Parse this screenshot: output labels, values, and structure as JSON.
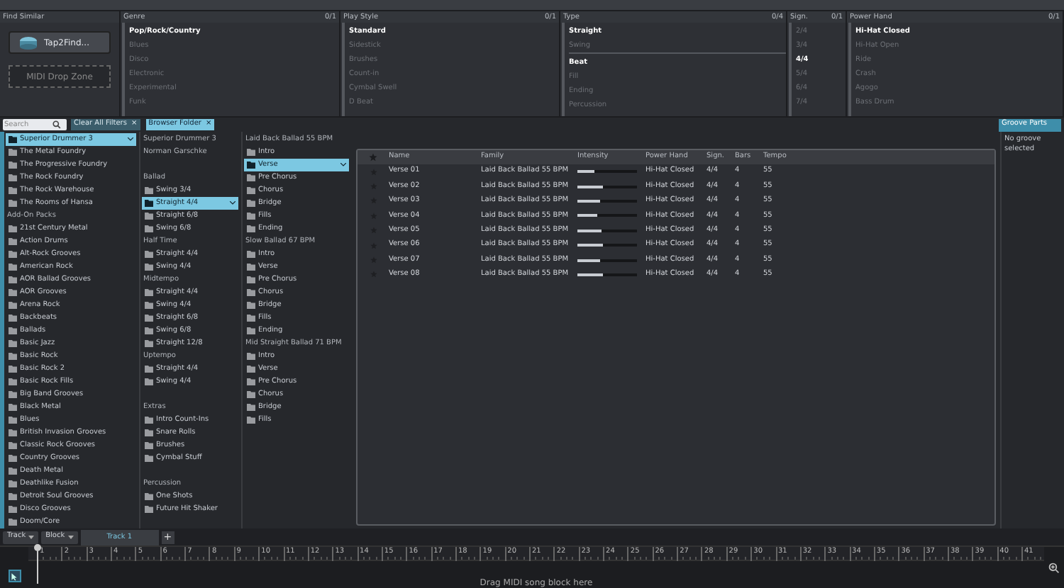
{
  "find_similar": {
    "title": "Find Similar",
    "tap_button": "Tap2Find...",
    "drop_zone": "MIDI Drop Zone"
  },
  "filters": [
    {
      "title": "Genre",
      "count": "0/1",
      "groups": [
        [
          {
            "label": "Pop/Rock/Country",
            "selected": true
          },
          {
            "label": "Blues",
            "selected": false
          },
          {
            "label": "Disco",
            "selected": false
          },
          {
            "label": "Electronic",
            "selected": false
          },
          {
            "label": "Experimental",
            "selected": false
          },
          {
            "label": "Funk",
            "selected": false
          }
        ]
      ]
    },
    {
      "title": "Play Style",
      "count": "0/1",
      "groups": [
        [
          {
            "label": "Standard",
            "selected": true
          },
          {
            "label": "Sidestick",
            "selected": false
          },
          {
            "label": "Brushes",
            "selected": false
          },
          {
            "label": "Count-in",
            "selected": false
          },
          {
            "label": "Cymbal Swell",
            "selected": false
          },
          {
            "label": "D Beat",
            "selected": false
          }
        ]
      ]
    },
    {
      "title": "Type",
      "count": "0/4",
      "groups": [
        [
          {
            "label": "Straight",
            "selected": true
          },
          {
            "label": "Swing",
            "selected": false
          }
        ],
        [
          {
            "label": "Beat",
            "selected": true
          },
          {
            "label": "Fill",
            "selected": false
          },
          {
            "label": "Ending",
            "selected": false
          },
          {
            "label": "Percussion",
            "selected": false
          }
        ]
      ]
    },
    {
      "title": "Sign.",
      "count": "0/1",
      "groups": [
        [
          {
            "label": "2/4",
            "selected": false
          },
          {
            "label": "3/4",
            "selected": false
          },
          {
            "label": "4/4",
            "selected": true
          },
          {
            "label": "5/4",
            "selected": false
          },
          {
            "label": "6/4",
            "selected": false
          },
          {
            "label": "7/4",
            "selected": false
          }
        ]
      ]
    },
    {
      "title": "Power Hand",
      "count": "0/1",
      "groups": [
        [
          {
            "label": "Hi-Hat Closed",
            "selected": true
          },
          {
            "label": "Hi-Hat Open",
            "selected": false
          },
          {
            "label": "Ride",
            "selected": false
          },
          {
            "label": "Crash",
            "selected": false
          },
          {
            "label": "Agogo",
            "selected": false
          },
          {
            "label": "Bass Drum",
            "selected": false
          }
        ]
      ]
    }
  ],
  "search": {
    "placeholder": "Search"
  },
  "chips": [
    {
      "label": "Clear All Filters",
      "remove": "×"
    },
    {
      "label": "Browser Folder",
      "remove": "×"
    }
  ],
  "folder_columns": [
    [
      {
        "kind": "folder",
        "label": "Superior Drummer 3",
        "selected": true
      },
      {
        "kind": "folder",
        "label": "The Metal Foundry",
        "selected": false
      },
      {
        "kind": "folder",
        "label": "The Progressive Foundry",
        "selected": false
      },
      {
        "kind": "folder",
        "label": "The Rock Foundry",
        "selected": false
      },
      {
        "kind": "folder",
        "label": "The Rock Warehouse",
        "selected": false
      },
      {
        "kind": "folder",
        "label": "The Rooms of Hansa",
        "selected": false
      },
      {
        "kind": "header",
        "label": "Add-On Packs",
        "gap_before": false
      },
      {
        "kind": "folder",
        "label": "21st Century Metal",
        "selected": false
      },
      {
        "kind": "folder",
        "label": "Action Drums",
        "selected": false
      },
      {
        "kind": "folder",
        "label": "Alt-Rock Grooves",
        "selected": false
      },
      {
        "kind": "folder",
        "label": "American Rock",
        "selected": false
      },
      {
        "kind": "folder",
        "label": "AOR Ballad Grooves",
        "selected": false
      },
      {
        "kind": "folder",
        "label": "AOR Grooves",
        "selected": false
      },
      {
        "kind": "folder",
        "label": "Arena Rock",
        "selected": false
      },
      {
        "kind": "folder",
        "label": "Backbeats",
        "selected": false
      },
      {
        "kind": "folder",
        "label": "Ballads",
        "selected": false
      },
      {
        "kind": "folder",
        "label": "Basic Jazz",
        "selected": false
      },
      {
        "kind": "folder",
        "label": "Basic Rock",
        "selected": false
      },
      {
        "kind": "folder",
        "label": "Basic Rock 2",
        "selected": false
      },
      {
        "kind": "folder",
        "label": "Basic Rock Fills",
        "selected": false
      },
      {
        "kind": "folder",
        "label": "Big Band Grooves",
        "selected": false
      },
      {
        "kind": "folder",
        "label": "Black Metal",
        "selected": false
      },
      {
        "kind": "folder",
        "label": "Blues",
        "selected": false
      },
      {
        "kind": "folder",
        "label": "British Invasion Grooves",
        "selected": false
      },
      {
        "kind": "folder",
        "label": "Classic Rock Grooves",
        "selected": false
      },
      {
        "kind": "folder",
        "label": "Country Grooves",
        "selected": false
      },
      {
        "kind": "folder",
        "label": "Death Metal",
        "selected": false
      },
      {
        "kind": "folder",
        "label": "Deathlike Fusion",
        "selected": false
      },
      {
        "kind": "folder",
        "label": "Detroit Soul Grooves",
        "selected": false
      },
      {
        "kind": "folder",
        "label": "Disco Grooves",
        "selected": false
      },
      {
        "kind": "folder",
        "label": "Doom/Core",
        "selected": false
      }
    ],
    [
      {
        "kind": "header",
        "label": "Superior Drummer 3",
        "gap_before": false
      },
      {
        "kind": "header",
        "label": "Norman Garschke",
        "gap_before": false
      },
      {
        "kind": "header",
        "label": "Ballad",
        "gap_before": true
      },
      {
        "kind": "folder",
        "label": "Swing 3/4",
        "selected": false
      },
      {
        "kind": "folder",
        "label": "Straight 4/4",
        "selected": true
      },
      {
        "kind": "folder",
        "label": "Straight 6/8",
        "selected": false
      },
      {
        "kind": "folder",
        "label": "Swing 6/8",
        "selected": false
      },
      {
        "kind": "header",
        "label": "Half Time",
        "gap_before": false
      },
      {
        "kind": "folder",
        "label": "Straight 4/4",
        "selected": false
      },
      {
        "kind": "folder",
        "label": "Swing 4/4",
        "selected": false
      },
      {
        "kind": "header",
        "label": "Midtempo",
        "gap_before": false
      },
      {
        "kind": "folder",
        "label": "Straight 4/4",
        "selected": false
      },
      {
        "kind": "folder",
        "label": "Swing 4/4",
        "selected": false
      },
      {
        "kind": "folder",
        "label": "Straight 6/8",
        "selected": false
      },
      {
        "kind": "folder",
        "label": "Swing 6/8",
        "selected": false
      },
      {
        "kind": "folder",
        "label": "Straight 12/8",
        "selected": false
      },
      {
        "kind": "header",
        "label": "Uptempo",
        "gap_before": false
      },
      {
        "kind": "folder",
        "label": "Straight 4/4",
        "selected": false
      },
      {
        "kind": "folder",
        "label": "Swing 4/4",
        "selected": false
      },
      {
        "kind": "header",
        "label": "Extras",
        "gap_before": true
      },
      {
        "kind": "folder",
        "label": "Intro Count-Ins",
        "selected": false
      },
      {
        "kind": "folder",
        "label": "Snare Rolls",
        "selected": false
      },
      {
        "kind": "folder",
        "label": "Brushes",
        "selected": false
      },
      {
        "kind": "folder",
        "label": "Cymbal Stuff",
        "selected": false
      },
      {
        "kind": "header",
        "label": "Percussion",
        "gap_before": true
      },
      {
        "kind": "folder",
        "label": "One Shots",
        "selected": false
      },
      {
        "kind": "folder",
        "label": "Future Hit Shaker",
        "selected": false
      }
    ],
    [
      {
        "kind": "header",
        "label": "Laid Back Ballad 55 BPM",
        "gap_before": false
      },
      {
        "kind": "folder",
        "label": "Intro",
        "selected": false
      },
      {
        "kind": "folder",
        "label": "Verse",
        "selected": true
      },
      {
        "kind": "folder",
        "label": "Pre Chorus",
        "selected": false
      },
      {
        "kind": "folder",
        "label": "Chorus",
        "selected": false
      },
      {
        "kind": "folder",
        "label": "Bridge",
        "selected": false
      },
      {
        "kind": "folder",
        "label": "Fills",
        "selected": false
      },
      {
        "kind": "folder",
        "label": "Ending",
        "selected": false
      },
      {
        "kind": "header",
        "label": "Slow Ballad 67 BPM",
        "gap_before": false
      },
      {
        "kind": "folder",
        "label": "Intro",
        "selected": false
      },
      {
        "kind": "folder",
        "label": "Verse",
        "selected": false
      },
      {
        "kind": "folder",
        "label": "Pre Chorus",
        "selected": false
      },
      {
        "kind": "folder",
        "label": "Chorus",
        "selected": false
      },
      {
        "kind": "folder",
        "label": "Bridge",
        "selected": false
      },
      {
        "kind": "folder",
        "label": "Fills",
        "selected": false
      },
      {
        "kind": "folder",
        "label": "Ending",
        "selected": false
      },
      {
        "kind": "header",
        "label": "Mid Straight Ballad 71 BPM",
        "gap_before": false
      },
      {
        "kind": "folder",
        "label": "Intro",
        "selected": false
      },
      {
        "kind": "folder",
        "label": "Verse",
        "selected": false
      },
      {
        "kind": "folder",
        "label": "Pre Chorus",
        "selected": false
      },
      {
        "kind": "folder",
        "label": "Chorus",
        "selected": false
      },
      {
        "kind": "folder",
        "label": "Bridge",
        "selected": false
      },
      {
        "kind": "folder",
        "label": "Fills",
        "selected": false
      }
    ]
  ],
  "table": {
    "columns": [
      "Name",
      "Family",
      "Intensity",
      "Power Hand",
      "Sign.",
      "Bars",
      "Tempo"
    ],
    "rows": [
      {
        "name": "Verse 01",
        "family": "Laid Back Ballad 55 BPM",
        "level": 0.28,
        "power_hand": "Hi-Hat Closed",
        "sign": "4/4",
        "bars": "4",
        "tempo": "55"
      },
      {
        "name": "Verse 02",
        "family": "Laid Back Ballad 55 BPM",
        "level": 0.44,
        "power_hand": "Hi-Hat Closed",
        "sign": "4/4",
        "bars": "4",
        "tempo": "55"
      },
      {
        "name": "Verse 03",
        "family": "Laid Back Ballad 55 BPM",
        "level": 0.38,
        "power_hand": "Hi-Hat Closed",
        "sign": "4/4",
        "bars": "4",
        "tempo": "55"
      },
      {
        "name": "Verse 04",
        "family": "Laid Back Ballad 55 BPM",
        "level": 0.34,
        "power_hand": "Hi-Hat Closed",
        "sign": "4/4",
        "bars": "4",
        "tempo": "55"
      },
      {
        "name": "Verse 05",
        "family": "Laid Back Ballad 55 BPM",
        "level": 0.41,
        "power_hand": "Hi-Hat Closed",
        "sign": "4/4",
        "bars": "4",
        "tempo": "55"
      },
      {
        "name": "Verse 06",
        "family": "Laid Back Ballad 55 BPM",
        "level": 0.44,
        "power_hand": "Hi-Hat Closed",
        "sign": "4/4",
        "bars": "4",
        "tempo": "55"
      },
      {
        "name": "Verse 07",
        "family": "Laid Back Ballad 55 BPM",
        "level": 0.38,
        "power_hand": "Hi-Hat Closed",
        "sign": "4/4",
        "bars": "4",
        "tempo": "55"
      },
      {
        "name": "Verse 08",
        "family": "Laid Back Ballad 55 BPM",
        "level": 0.44,
        "power_hand": "Hi-Hat Closed",
        "sign": "4/4",
        "bars": "4",
        "tempo": "55"
      }
    ]
  },
  "groove_parts": {
    "tab": "Groove Parts",
    "message": "No groove selected"
  },
  "timeline": {
    "menus": [
      "Track",
      "Block"
    ],
    "tabs": [
      {
        "label": "Track 1",
        "selected": true
      }
    ],
    "add": "+",
    "ruler": [
      "1",
      "2",
      "3",
      "4",
      "5",
      "6",
      "7",
      "8",
      "9",
      "10",
      "11",
      "12",
      "13",
      "14",
      "15",
      "16",
      "17",
      "18",
      "19",
      "20",
      "21",
      "22",
      "23",
      "24",
      "25",
      "26",
      "27",
      "28",
      "29",
      "30",
      "31",
      "32",
      "33",
      "34",
      "35",
      "36",
      "37",
      "38",
      "39",
      "40",
      "41"
    ],
    "hint": "Drag MIDI song block here"
  }
}
